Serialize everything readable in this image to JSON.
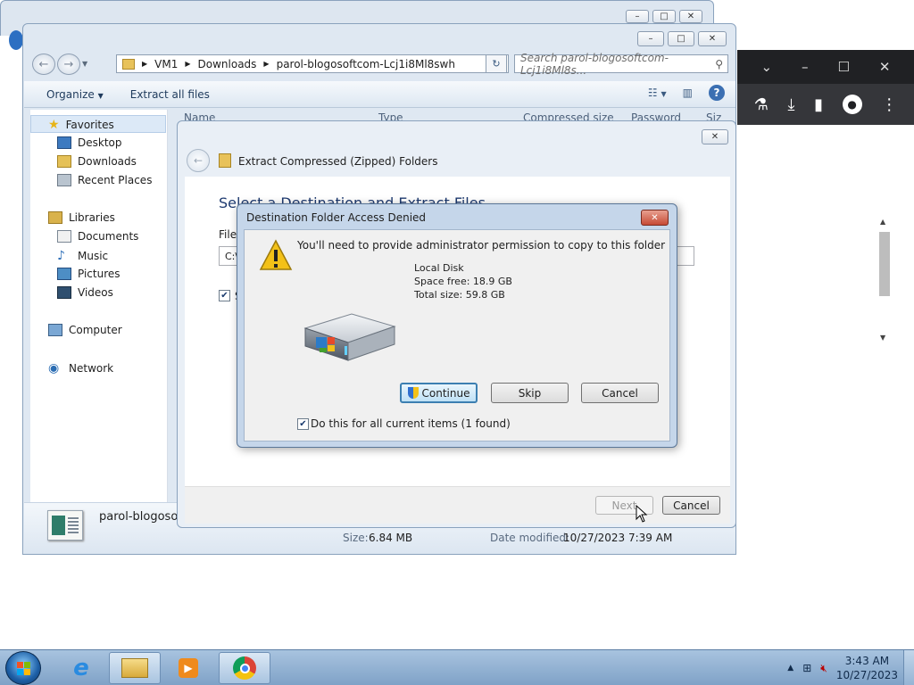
{
  "explorer": {
    "address": {
      "crumbs": [
        "VM1",
        "Downloads",
        "parol-blogosoftcom-Lcj1i8Ml8swh"
      ]
    },
    "search_placeholder": "Search parol-blogosoftcom-Lcj1i8Ml8s...",
    "toolbar": {
      "organize": "Organize",
      "extract_all": "Extract all files"
    },
    "columns": [
      "Name",
      "Type",
      "Compressed size",
      "Password",
      "Siz"
    ],
    "nav": {
      "favorites": "Favorites",
      "desktop": "Desktop",
      "downloads": "Downloads",
      "recent": "Recent Places",
      "libraries": "Libraries",
      "documents": "Documents",
      "music": "Music",
      "pictures": "Pictures",
      "videos": "Videos",
      "computer": "Computer",
      "network": "Network"
    },
    "details": {
      "name": "parol-blogosof",
      "size_label": "Size:",
      "size_value": "6.84 MB",
      "modified_label": "Date modified:",
      "modified_value": "10/27/2023 7:39 AM"
    }
  },
  "wizard": {
    "title": "Extract Compressed (Zipped) Folders",
    "heading": "Select a Destination and Extract Files",
    "files_label": "Files",
    "path_value": "C:\\",
    "checkbox_label": "S",
    "next": "Next",
    "cancel": "Cancel"
  },
  "dialog": {
    "title": "Destination Folder Access Denied",
    "message": "You'll need to provide administrator permission to copy to this folder",
    "disk_name": "Local Disk",
    "space_free": "Space free: 18.9 GB",
    "total_size": "Total size: 59.8 GB",
    "continue": "Continue",
    "skip": "Skip",
    "cancel": "Cancel",
    "do_for_all": "Do this for all current items (1 found)",
    "do_for_all_checked": true
  },
  "taskbar": {
    "time": "3:43 AM",
    "date": "10/27/2023"
  },
  "colors": {
    "accent": "#3b6fb2",
    "taskbar": "#8fb0d2",
    "dialog_frame": "#c5d6ea"
  }
}
